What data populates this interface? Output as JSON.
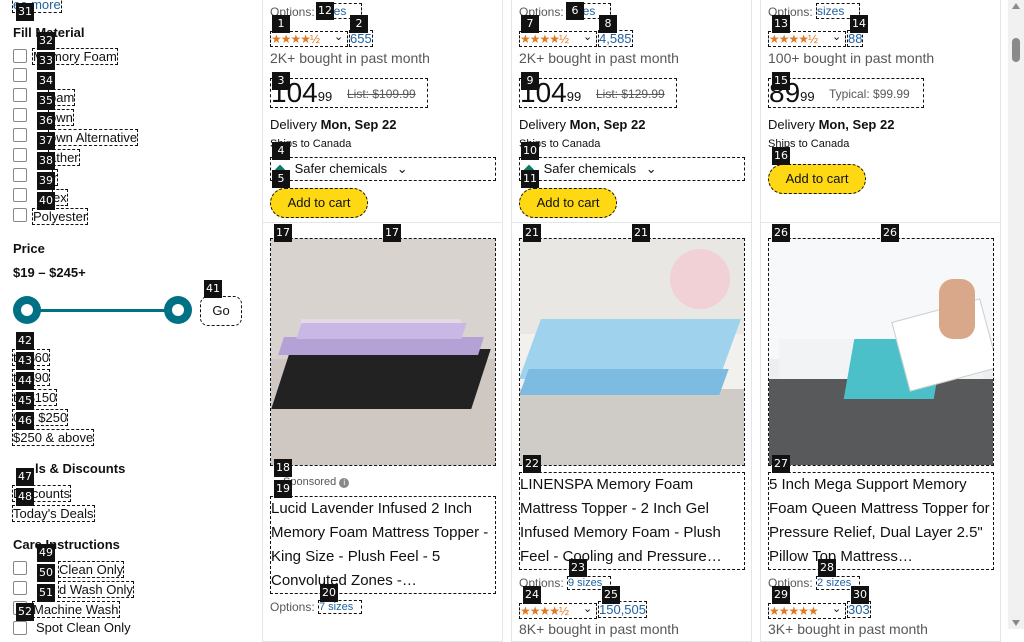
{
  "sidebar": {
    "see_more": "ee more",
    "fill_material": {
      "title": "Fill Material",
      "items": [
        "Memory Foam",
        "",
        "",
        "oam",
        "own",
        "own Alternative",
        "ather",
        "r",
        "ex",
        "Polyester"
      ]
    },
    "price": {
      "title": "Price",
      "range": "$19 – $245+",
      "go_label": "Go",
      "slider_min": 0,
      "slider_max": 1,
      "ranges": [
        "to $60",
        "to $90",
        "to $150",
        "0 to $250",
        "$250 & above"
      ]
    },
    "deals": {
      "title": "ls & Discounts",
      "items": [
        "Discounts",
        "Today's Deals"
      ]
    },
    "care": {
      "title": "Care Instructions",
      "items": [
        "Clean Only",
        "d Wash Only",
        "Machine Wash",
        "Spot Clean Only"
      ]
    }
  },
  "top_cards": [
    {
      "options": "Options:",
      "sizes": "sizes",
      "stars": "★★★★½",
      "reviews": "655",
      "bought": "2K+ bought in past month",
      "price_whole": "104",
      "price_frac": "99",
      "list_label": "List: $109.99",
      "delivery_label": "Delivery",
      "delivery_date": "Mon, Sep 22",
      "ships": "Ships to Canada",
      "badge": "Safer chemicals",
      "cart": "Add to cart"
    },
    {
      "options": "Options:",
      "sizes": "sizes",
      "stars": "★★★★½",
      "reviews": "4,585",
      "bought": "2K+ bought in past month",
      "price_whole": "104",
      "price_frac": "99",
      "list_label": "List: $129.99",
      "delivery_label": "Delivery",
      "delivery_date": "Mon, Sep 22",
      "ships": "Ships to Canada",
      "badge": "Safer chemicals",
      "cart": "Add to cart"
    },
    {
      "options": "Options:",
      "sizes": "sizes",
      "stars": "★★★★½",
      "reviews": "88",
      "bought": "100+ bought in past month",
      "price_whole": "89",
      "price_frac": "99",
      "list_label": "Typical: $99.99",
      "delivery_label": "Delivery",
      "delivery_date": "Mon, Sep 22",
      "ships": "Ships to Canada",
      "cart": "Add to cart"
    }
  ],
  "bottom_cards": [
    {
      "sponsored": "Sponsored",
      "title": "Lucid Lavender Infused 2 Inch Memory Foam Mattress Topper - King Size - Plush Feel - 5 Convoluted Zones -…",
      "options": "Options:",
      "sizes": "7 sizes"
    },
    {
      "title": "LINENSPA Memory Foam Mattress Topper - 2 Inch Gel Infused Memory Foam - Plush Feel - Cooling and Pressure…",
      "options": "Options:",
      "sizes": "9 sizes",
      "stars": "★★★★½",
      "reviews": "150,505",
      "bought": "8K+ bought in past month"
    },
    {
      "title": "5 Inch Mega Support Memory Foam Queen Mattress Topper for Pressure Relief, Dual Layer 2.5\" Pillow Top Mattress…",
      "options": "Options:",
      "sizes": "2 sizes",
      "stars": "★★★★★",
      "reviews": "303",
      "bought": "3K+ bought in past month"
    }
  ],
  "badges": [
    "1",
    "2",
    "3",
    "4",
    "5",
    "6",
    "7",
    "8",
    "9",
    "10",
    "11",
    "12",
    "13",
    "14",
    "15",
    "16",
    "17",
    "18",
    "19",
    "20",
    "21",
    "22",
    "23",
    "24",
    "25",
    "26",
    "27",
    "28",
    "29",
    "30",
    "31",
    "32",
    "33",
    "34",
    "35",
    "36",
    "37",
    "38",
    "39",
    "40",
    "41",
    "42",
    "43",
    "44",
    "45",
    "46",
    "47",
    "48",
    "49",
    "50",
    "51",
    "52"
  ],
  "colors": {
    "accent": "#ffd814",
    "link": "#2162a1",
    "star": "#de7921"
  }
}
